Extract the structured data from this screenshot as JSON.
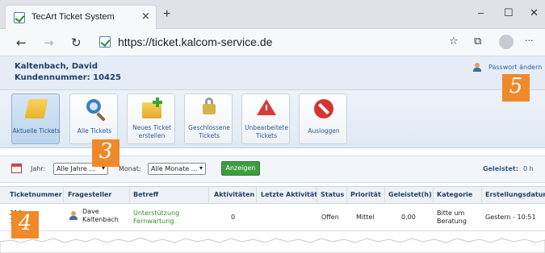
{
  "browser": {
    "tab_title": "TecArt Ticket System",
    "tab_close": "×",
    "new_tab": "+",
    "url": "https://ticket.kalcom-service.de",
    "minimize": "–",
    "maximize": "☐",
    "close": "✕",
    "more": "···"
  },
  "header": {
    "user_name": "Kaltenbach, David",
    "customer_number": "Kundennummer: 10425",
    "password_link": "Passwort ändern"
  },
  "toolbar": {
    "buttons": [
      {
        "line1": "Aktuelle Tickets",
        "line2": ""
      },
      {
        "line1": "Alle Tickets",
        "line2": ""
      },
      {
        "line1": "Neues Ticket",
        "line2": "erstellen"
      },
      {
        "line1": "Geschlossene",
        "line2": "Tickets"
      },
      {
        "line1": "Unbearbeitete",
        "line2": "Tickets"
      },
      {
        "line1": "Ausloggen",
        "line2": ""
      }
    ]
  },
  "filter": {
    "year_label": "Jahr:",
    "year_value": "Alle Jahre ...",
    "month_label": "Monat:",
    "month_value": "Alle Monate ...",
    "show_button": "Anzeigen",
    "geleistet_label": "Geleistet:",
    "geleistet_value": "0 h"
  },
  "table": {
    "headers": [
      "Ticketnummer",
      "Fragesteller",
      "Betreff",
      "Aktivitäten",
      "Letzte Aktivität",
      "Status",
      "Priorität",
      "Geleistet(h)",
      "Kategorie",
      "Erstellungsdatum"
    ],
    "row": {
      "ticket_line1": "210",
      "ticket_line2": "100",
      "requester_line1": "Dave",
      "requester_line2": "Kaltenbach",
      "subject_line1": "Unterstützung",
      "subject_line2": "Fernwartung",
      "activities": "0",
      "last_activity": "",
      "status": "Offen",
      "priority": "Mittel",
      "hours": "0,00",
      "category_line1": "Bitte um",
      "category_line2": "Beratung",
      "created": "Gestern - 10:51"
    }
  },
  "markers": {
    "m3": "3",
    "m4": "4",
    "m5": "5"
  },
  "colors": {
    "accent_blue": "#2a5a95",
    "button_green": "#3f9b3f",
    "marker_orange": "#f0892a",
    "link_green": "#3b8a2f"
  }
}
